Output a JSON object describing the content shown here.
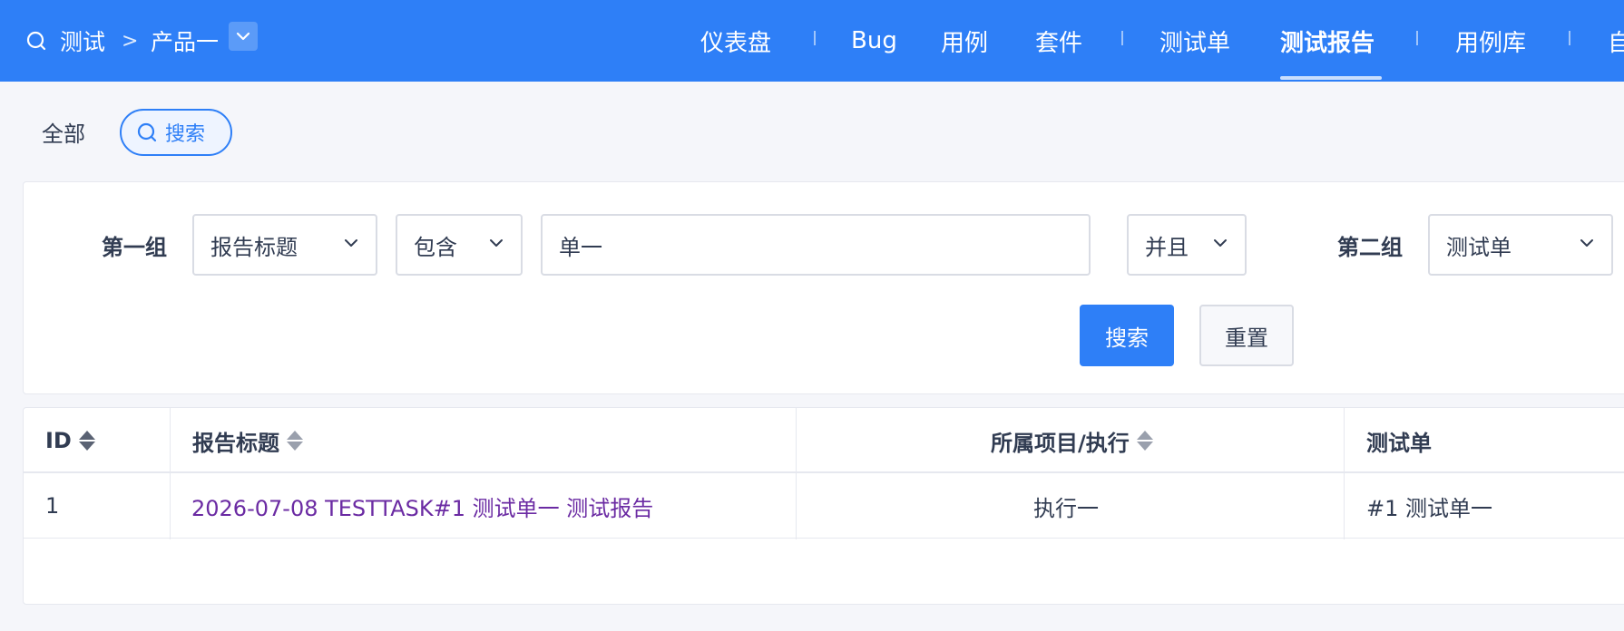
{
  "header": {
    "breadcrumb_root": "测试",
    "breadcrumb_separator": ">",
    "product": "产品一",
    "nav": [
      {
        "label": "仪表盘"
      },
      {
        "label": "Bug"
      },
      {
        "label": "用例"
      },
      {
        "label": "套件"
      },
      {
        "label": "测试单"
      },
      {
        "label": "测试报告",
        "active": true
      },
      {
        "label": "用例库"
      },
      {
        "label": "自"
      }
    ],
    "color": "#2e7ff7"
  },
  "filters": {
    "all_label": "全部",
    "search_label": "搜索"
  },
  "search_panel": {
    "group1_label": "第一组",
    "group1_field": "报告标题",
    "group1_operator": "包含",
    "group1_value": "单一",
    "logic": "并且",
    "group2_label": "第二组",
    "group2_field": "测试单",
    "search_button": "搜索",
    "reset_button": "重置"
  },
  "table": {
    "columns": [
      {
        "label": "ID",
        "sortable": true
      },
      {
        "label": "报告标题",
        "sortable": true
      },
      {
        "label": "所属项目/执行",
        "sortable": true
      },
      {
        "label": "测试单",
        "sortable": false
      }
    ],
    "rows": [
      {
        "id": "1",
        "title": "2026-07-08 TESTTASK#1 测试单一 测试报告",
        "execution": "执行一",
        "testtask": "#1 测试单一"
      }
    ]
  }
}
